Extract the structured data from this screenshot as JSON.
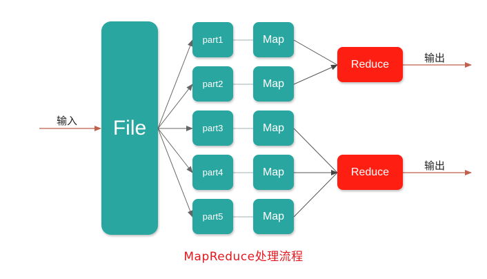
{
  "input_label": "输入",
  "file_label": "File",
  "parts": [
    "part1",
    "part2",
    "part3",
    "part4",
    "part5"
  ],
  "map_label": "Map",
  "reduce_label": "Reduce",
  "output_label": "输出",
  "caption": "MapReduce处理流程",
  "colors": {
    "node": "#2aa6a1",
    "reduce": "#ff1e12",
    "arrow_io": "#c0614a",
    "connector": "#666666",
    "caption": "#e4171c"
  }
}
